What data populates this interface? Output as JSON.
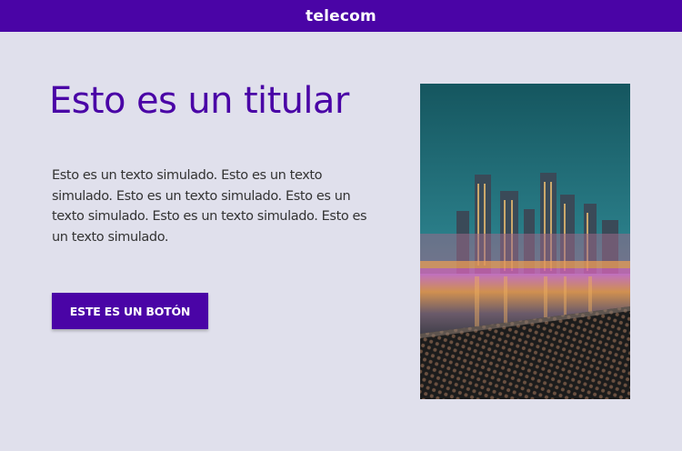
{
  "header": {
    "logo": "telecom",
    "brand_color": "#4a04a6"
  },
  "hero": {
    "title": "Esto es un titular",
    "body": "Esto es un texto simulado. Esto es un texto simulado. Esto es un texto simulado. Esto es un texto simulado. Esto es un texto simulado. Esto es un texto simulado.",
    "button_label": "ESTE ES UN BOTÓN"
  },
  "image": {
    "subject": "city skyline at night reflected in water"
  },
  "colors": {
    "background": "#e0e0ec",
    "text": "#333333",
    "button_text": "#ffffff"
  }
}
